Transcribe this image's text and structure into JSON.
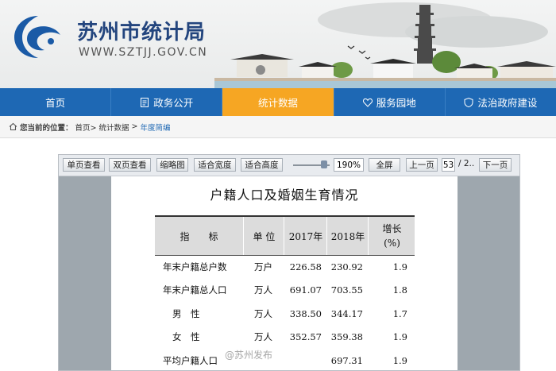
{
  "site": {
    "name": "苏州市统计局",
    "url": "WWW.SZTJJ.GOV.CN"
  },
  "nav": [
    {
      "label": "首页",
      "icon": "none"
    },
    {
      "label": "政务公开",
      "icon": "document-icon"
    },
    {
      "label": "统计数据",
      "icon": "none",
      "active": true
    },
    {
      "label": "服务园地",
      "icon": "heart-icon"
    },
    {
      "label": "法治政府建设",
      "icon": "shield-icon"
    }
  ],
  "breadcrumb": {
    "prefix": "您当前的位置：",
    "items": [
      "首页>",
      "统计数据",
      ">",
      "年度简编"
    ]
  },
  "toolbar": {
    "single_page": "单页查看",
    "double_page": "双页查看",
    "thumbnails": "缩略图",
    "fit_width": "适合宽度",
    "fit_height": "适合高度",
    "zoom": "190%",
    "fullscreen": "全屏",
    "prev": "上一页",
    "page": "53",
    "total": "/ 2..",
    "next": "下一页"
  },
  "document": {
    "title": "户籍人口及婚姻生育情况",
    "columns": [
      "指　　标",
      "单 位",
      "2017年",
      "2018年",
      "增长\n(%)"
    ],
    "rows": [
      {
        "name": "年末户籍总户数",
        "unit": "万户",
        "y2017": "226.58",
        "y2018": "230.92",
        "growth": "1.9"
      },
      {
        "name": "年末户籍总人口",
        "unit": "万人",
        "y2017": "691.07",
        "y2018": "703.55",
        "growth": "1.8"
      },
      {
        "name": "男　性",
        "unit": "万人",
        "y2017": "338.50",
        "y2018": "344.17",
        "growth": "1.7"
      },
      {
        "name": "女　性",
        "unit": "万人",
        "y2017": "352.57",
        "y2018": "359.38",
        "growth": "1.9"
      },
      {
        "name": "平均户籍人口",
        "unit": "",
        "y2017": "",
        "y2018": "697.31",
        "growth": "1.9"
      }
    ]
  },
  "watermark": "@苏州发布",
  "colors": {
    "nav_bg": "#1e68b4",
    "nav_active": "#f6a623",
    "brand": "#23457e"
  }
}
